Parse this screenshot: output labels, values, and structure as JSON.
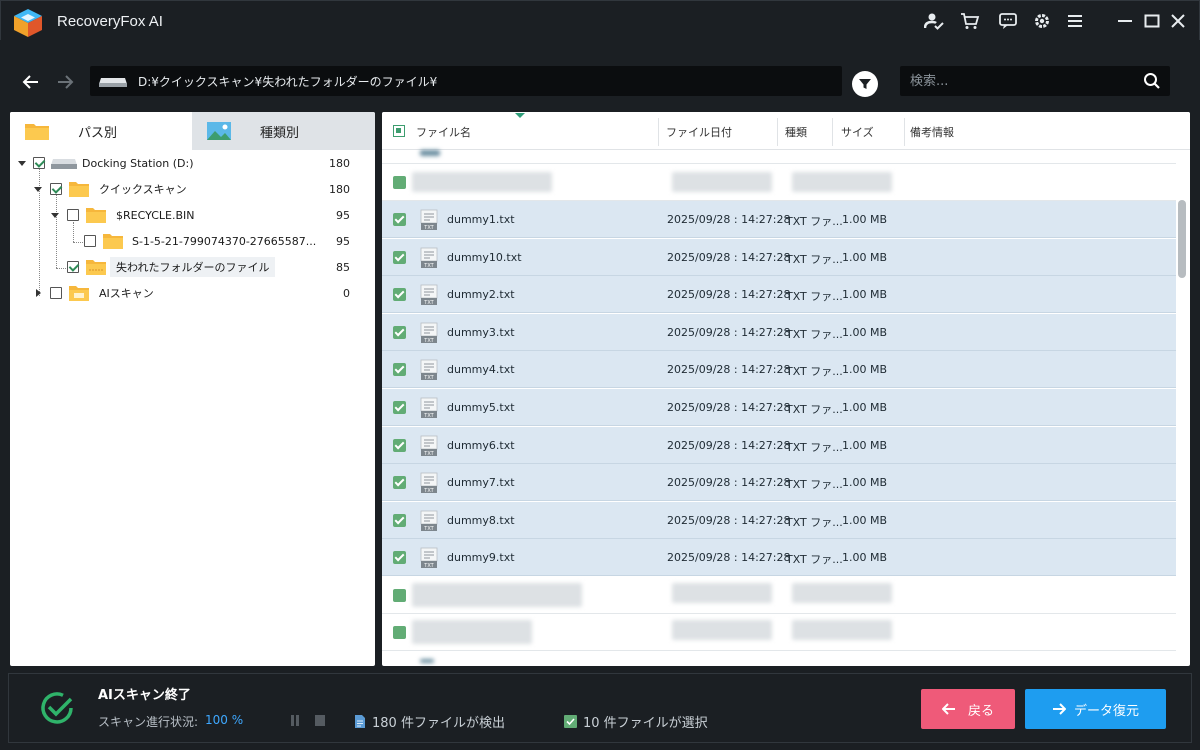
{
  "app": {
    "title": "RecoveryFox AI"
  },
  "titlebar_icons": [
    "account-check-icon",
    "cart-icon",
    "feedback-icon",
    "settings-icon",
    "menu-icon",
    "minimize-icon",
    "maximize-icon",
    "close-icon"
  ],
  "address": {
    "path": "D:¥クイックスキャン¥失われたフォルダーのファイル¥"
  },
  "search": {
    "placeholder": "検索..."
  },
  "left_tabs": [
    {
      "label": "パス別"
    },
    {
      "label": "種類別"
    }
  ],
  "tree": [
    {
      "label": "Docking Station (D:)",
      "count": "180",
      "checked": true
    },
    {
      "label": "クイックスキャン",
      "count": "180",
      "checked": true
    },
    {
      "label": "$RECYCLE.BIN",
      "count": "95",
      "checked": false
    },
    {
      "label": "S-1-5-21-799074370-27665587...",
      "count": "95",
      "checked": false
    },
    {
      "label": "失われたフォルダーのファイル",
      "count": "85",
      "checked": true
    },
    {
      "label": "AIスキャン",
      "count": "0",
      "checked": false
    }
  ],
  "table": {
    "columns": [
      "ファイル名",
      "ファイル日付",
      "種類",
      "サイズ",
      "備考情報"
    ],
    "rows": [
      {
        "name": "dummy1.txt",
        "date": "2025/09/28 : 14:27:28",
        "type": "TXT ファ...",
        "size": "1.00 MB"
      },
      {
        "name": "dummy10.txt",
        "date": "2025/09/28 : 14:27:28",
        "type": "TXT ファ...",
        "size": "1.00 MB"
      },
      {
        "name": "dummy2.txt",
        "date": "2025/09/28 : 14:27:28",
        "type": "TXT ファ...",
        "size": "1.00 MB"
      },
      {
        "name": "dummy3.txt",
        "date": "2025/09/28 : 14:27:28",
        "type": "TXT ファ...",
        "size": "1.00 MB"
      },
      {
        "name": "dummy4.txt",
        "date": "2025/09/28 : 14:27:28",
        "type": "TXT ファ...",
        "size": "1.00 MB"
      },
      {
        "name": "dummy5.txt",
        "date": "2025/09/28 : 14:27:28",
        "type": "TXT ファ...",
        "size": "1.00 MB"
      },
      {
        "name": "dummy6.txt",
        "date": "2025/09/28 : 14:27:28",
        "type": "TXT ファ...",
        "size": "1.00 MB"
      },
      {
        "name": "dummy7.txt",
        "date": "2025/09/28 : 14:27:28",
        "type": "TXT ファ...",
        "size": "1.00 MB"
      },
      {
        "name": "dummy8.txt",
        "date": "2025/09/28 : 14:27:28",
        "type": "TXT ファ...",
        "size": "1.00 MB"
      },
      {
        "name": "dummy9.txt",
        "date": "2025/09/28 : 14:27:28",
        "type": "TXT ファ...",
        "size": "1.00 MB"
      }
    ]
  },
  "footer": {
    "status_title": "AIスキャン終了",
    "progress_label": "スキャン進行状況:",
    "progress_value": "100 %",
    "found_text": "180 件ファイルが検出",
    "selected_text": "10 件ファイルが選択",
    "back_label": "戻る",
    "recover_label": "データ復元"
  },
  "colors": {
    "accent_blue": "#1e9df0",
    "back_pink": "#ef5a79",
    "check_green": "#62ac75",
    "selected_row": "#dbe7f2"
  }
}
